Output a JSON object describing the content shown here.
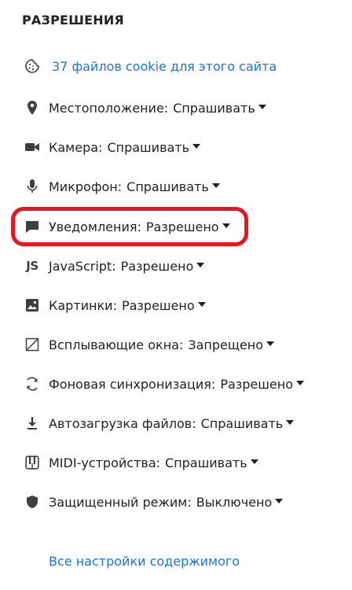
{
  "section": {
    "title": "РАЗРЕШЕНИЯ"
  },
  "cookies": {
    "icon": "cookie-icon",
    "label": "37 файлов cookie для этого сайта"
  },
  "permissions": [
    {
      "icon": "location-pin-icon",
      "label": "Местоположение:",
      "value": "Спрашивать"
    },
    {
      "icon": "camera-icon",
      "label": "Камера:",
      "value": "Спрашивать"
    },
    {
      "icon": "microphone-icon",
      "label": "Микрофон:",
      "value": "Спрашивать"
    },
    {
      "icon": "notification-bubble-icon",
      "label": "Уведомления:",
      "value": "Разрешено",
      "highlighted": true
    },
    {
      "icon": "javascript-icon",
      "label": "JavaScript:",
      "value": "Разрешено",
      "icon_text": "JS"
    },
    {
      "icon": "image-icon",
      "label": "Картинки:",
      "value": "Разрешено"
    },
    {
      "icon": "popup-blocked-icon",
      "label": "Всплывающие окна:",
      "value": "Запрещено"
    },
    {
      "icon": "sync-icon",
      "label": "Фоновая синхронизация:",
      "value": "Разрешено"
    },
    {
      "icon": "download-icon",
      "label": "Автозагрузка файлов:",
      "value": "Спрашивать"
    },
    {
      "icon": "midi-piano-icon",
      "label": "MIDI-устройства:",
      "value": "Спрашивать"
    },
    {
      "icon": "shield-icon",
      "label": "Защищенный режим:",
      "value": "Выключено"
    }
  ],
  "footer": {
    "all_settings": "Все настройки содержимого"
  },
  "colors": {
    "link": "#1a73e8",
    "highlight": "#e8141f",
    "text": "#202124",
    "icon": "#3c4043"
  }
}
